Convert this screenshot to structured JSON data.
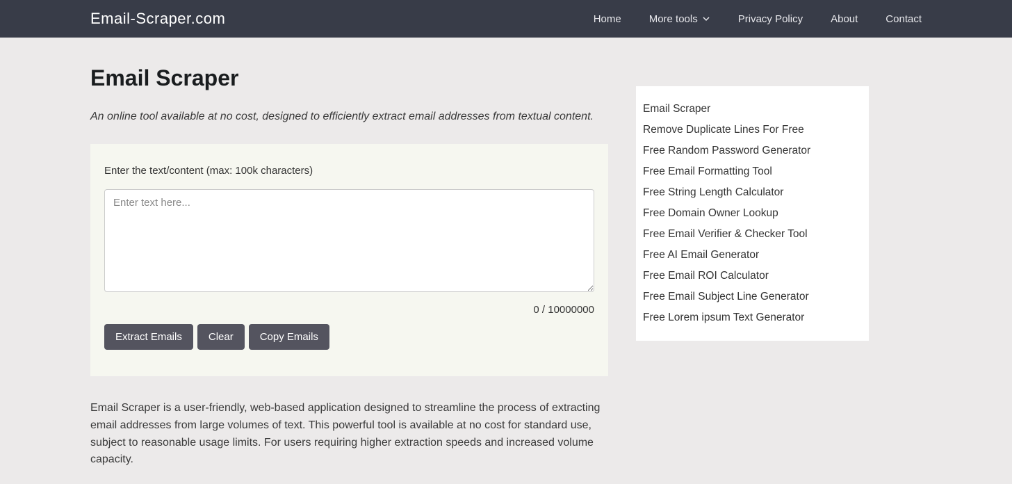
{
  "header": {
    "logo": "Email-Scraper.com",
    "nav": {
      "home": "Home",
      "more_tools": "More tools",
      "privacy": "Privacy Policy",
      "about": "About",
      "contact": "Contact"
    }
  },
  "main": {
    "title": "Email Scraper",
    "subtitle": "An online tool available at no cost, designed to efficiently extract email addresses from textual content.",
    "input_label": "Enter the text/content (max: 100k characters)",
    "placeholder": "Enter text here...",
    "counter": "0 / 10000000",
    "buttons": {
      "extract": "Extract Emails",
      "clear": "Clear",
      "copy": "Copy Emails"
    },
    "description": "Email Scraper is a user-friendly, web-based application designed to streamline the process of extracting email addresses from large volumes of text. This powerful tool is available at no cost for standard use, subject to reasonable usage limits. For users requiring higher extraction speeds and increased volume capacity."
  },
  "sidebar": {
    "items": [
      "Email Scraper",
      "Remove Duplicate Lines For Free",
      "Free Random Password Generator",
      "Free Email Formatting Tool",
      "Free String Length Calculator",
      "Free Domain Owner Lookup",
      "Free Email Verifier & Checker Tool",
      "Free AI Email Generator",
      "Free Email ROI Calculator",
      "Free Email Subject Line Generator",
      "Free Lorem ipsum Text Generator"
    ]
  }
}
